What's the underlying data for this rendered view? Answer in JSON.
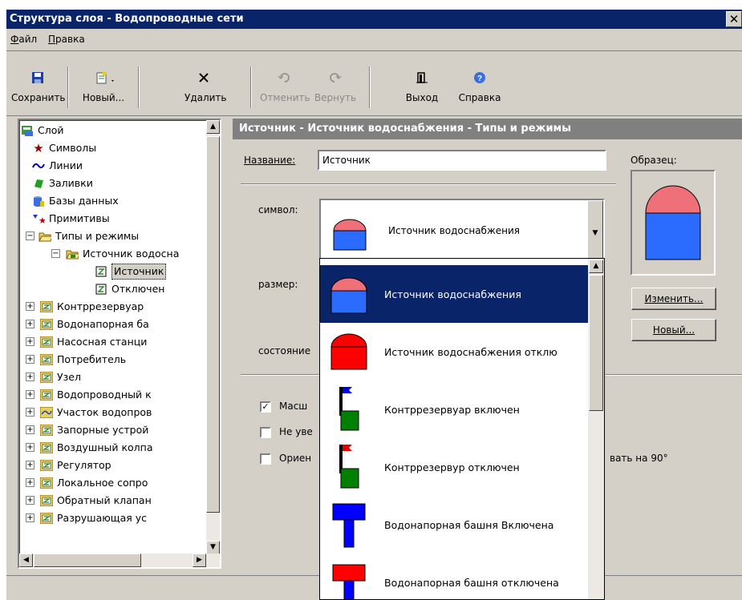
{
  "window": {
    "title": "Структура слоя - Водопроводные сети",
    "close": "✕"
  },
  "menu": [
    "Файл",
    "Правка"
  ],
  "toolbar": {
    "save": "Сохранить",
    "new": "Новый...",
    "delete": "Удалить",
    "undo": "Отменить",
    "redo": "Вернуть",
    "exit": "Выход",
    "help": "Справка"
  },
  "tree": {
    "root": "Слой",
    "symbols": "Символы",
    "lines": "Линии",
    "fills": "Заливки",
    "databases": "Базы данных",
    "primitives": "Примитивы",
    "types": "Типы и режимы",
    "source_group": "Источник водосна",
    "source_on": "Источник",
    "source_off": "Отключен",
    "items": [
      "Контррезервуар",
      "Водонапорная ба",
      "Насосная станци",
      "Потребитель",
      "Узел",
      "Водопроводный к",
      "Участок водопров",
      "Запорные устрой",
      "Воздушный колпа",
      "Регулятор",
      "Локальное сопро",
      "Обратный клапан",
      "Разрушающая ус"
    ]
  },
  "panel": {
    "header": "Источник - Источник водоснабжения - Типы и режимы",
    "name_label": "Название:",
    "name_value": "Источник",
    "sample_label": "Образец:",
    "symbol_label": "символ:",
    "symbol_value": "Источник водоснабжения",
    "size_label": "размер:",
    "state_label": "состояние",
    "change_btn": "Изменить...",
    "new_btn": "Новый...",
    "chk1": "Масш",
    "chk2": "Не уве",
    "chk3": "Ориен",
    "rotate_text": "вать на 90°"
  },
  "dropdown": [
    "Источник водоснабжения",
    "Источник водоснабжения отклю",
    "Контррезервуар включен",
    "Контррезервур отключен",
    "Водонапорная башня Включена",
    "Водонапорная башня отключена"
  ],
  "colors": {
    "titlebar": "#0a246a",
    "selection": "#0a246a",
    "blue": "#2b6cff",
    "red": "#ff0000",
    "pink": "#f0707a",
    "green": "#008000"
  }
}
